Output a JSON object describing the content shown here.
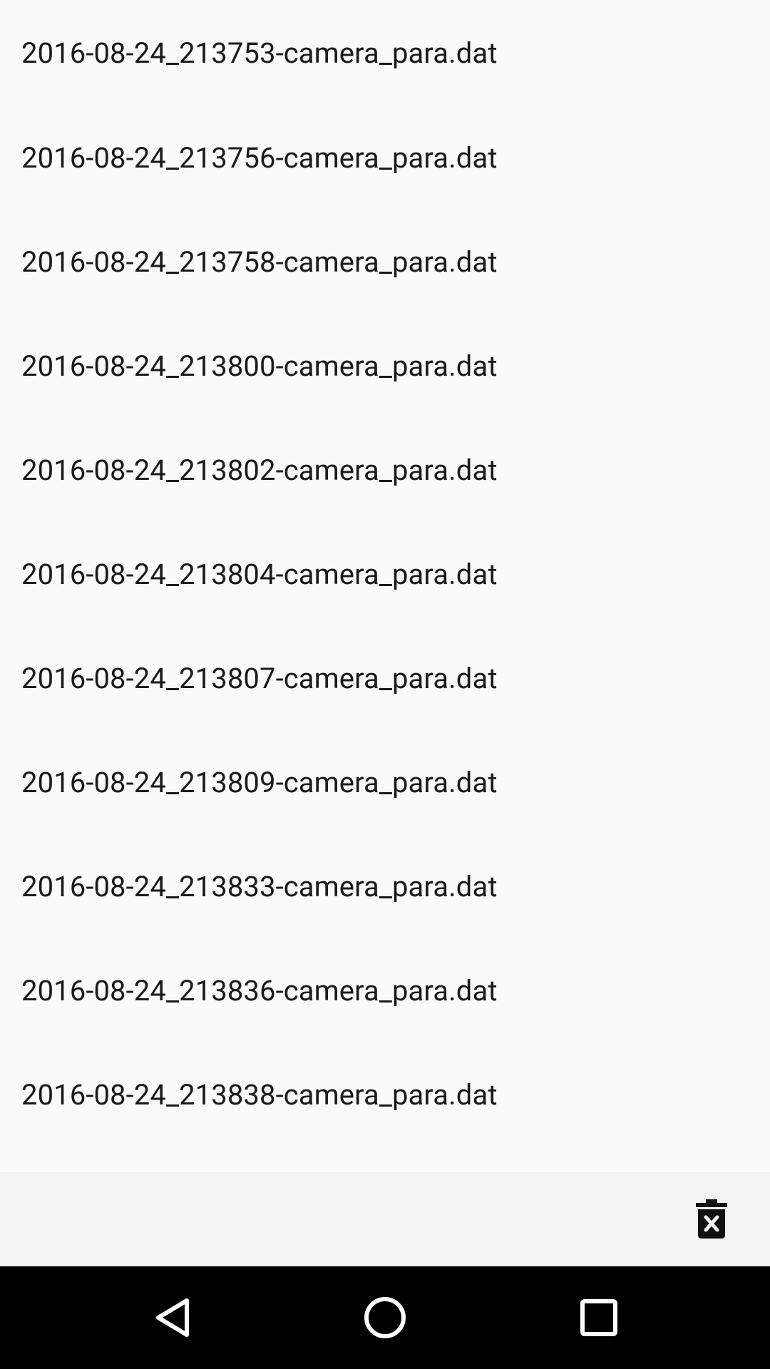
{
  "files": [
    {
      "name": "2016-08-24_213753-camera_para.dat"
    },
    {
      "name": "2016-08-24_213756-camera_para.dat"
    },
    {
      "name": "2016-08-24_213758-camera_para.dat"
    },
    {
      "name": "2016-08-24_213800-camera_para.dat"
    },
    {
      "name": "2016-08-24_213802-camera_para.dat"
    },
    {
      "name": "2016-08-24_213804-camera_para.dat"
    },
    {
      "name": "2016-08-24_213807-camera_para.dat"
    },
    {
      "name": "2016-08-24_213809-camera_para.dat"
    },
    {
      "name": "2016-08-24_213833-camera_para.dat"
    },
    {
      "name": "2016-08-24_213836-camera_para.dat"
    },
    {
      "name": "2016-08-24_213838-camera_para.dat"
    }
  ],
  "toolbar": {
    "delete_icon": "delete-forever-icon"
  },
  "navigation_bar": {
    "back_icon": "back-triangle-icon",
    "home_icon": "home-circle-icon",
    "recents_icon": "recents-square-icon"
  },
  "colors": {
    "background": "#fafafa",
    "toolbar_background": "#f3f3f3",
    "nav_background": "#000000",
    "text": "#1a1a1a"
  }
}
